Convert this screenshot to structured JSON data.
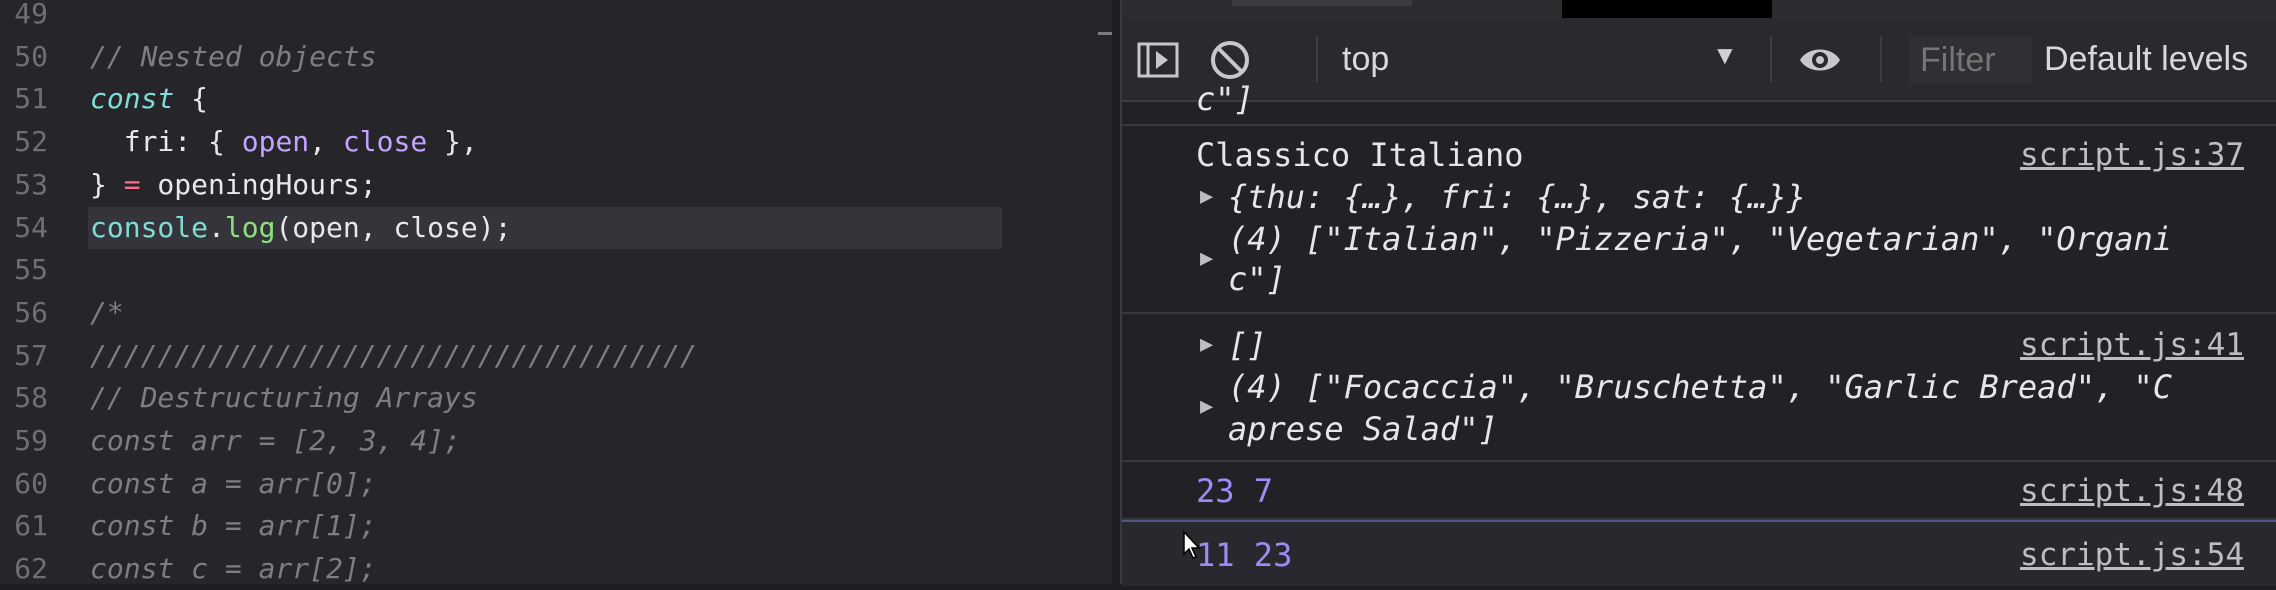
{
  "editor": {
    "lines": [
      {
        "num": "49",
        "tokens": []
      },
      {
        "num": "50",
        "tokens": [
          {
            "t": "// Nested objects",
            "c": "com"
          }
        ]
      },
      {
        "num": "51",
        "tokens": [
          {
            "t": "const",
            "c": "kw"
          },
          {
            "t": " {",
            "c": "txt"
          }
        ]
      },
      {
        "num": "52",
        "tokens": [
          {
            "t": "  fri",
            "c": "txt"
          },
          {
            "t": ": { ",
            "c": "txt"
          },
          {
            "t": "open",
            "c": "prop"
          },
          {
            "t": ", ",
            "c": "txt"
          },
          {
            "t": "close",
            "c": "prop"
          },
          {
            "t": " },",
            "c": "txt"
          }
        ]
      },
      {
        "num": "53",
        "tokens": [
          {
            "t": "} ",
            "c": "txt"
          },
          {
            "t": "=",
            "c": "op"
          },
          {
            "t": " openingHours;",
            "c": "txt"
          }
        ]
      },
      {
        "num": "54",
        "tokens": [
          {
            "t": "console",
            "c": "cons"
          },
          {
            "t": ".",
            "c": "txt"
          },
          {
            "t": "log",
            "c": "fn"
          },
          {
            "t": "(open, close);",
            "c": "txt"
          }
        ],
        "active": true
      },
      {
        "num": "55",
        "tokens": []
      },
      {
        "num": "56",
        "tokens": [
          {
            "t": "/*",
            "c": "com"
          }
        ]
      },
      {
        "num": "57",
        "tokens": [
          {
            "t": "////////////////////////////////////",
            "c": "com"
          }
        ]
      },
      {
        "num": "58",
        "tokens": [
          {
            "t": "// Destructuring Arrays",
            "c": "com"
          }
        ]
      },
      {
        "num": "59",
        "tokens": [
          {
            "t": "const arr = [2, 3, 4];",
            "c": "com"
          }
        ]
      },
      {
        "num": "60",
        "tokens": [
          {
            "t": "const a = arr[0];",
            "c": "com"
          }
        ]
      },
      {
        "num": "61",
        "tokens": [
          {
            "t": "const b = arr[1];",
            "c": "com"
          }
        ]
      },
      {
        "num": "62",
        "tokens": [
          {
            "t": "const c = arr[2];",
            "c": "com"
          }
        ]
      }
    ]
  },
  "devtools": {
    "toolbar": {
      "sidebar_icon": "sidebar-toggle-icon",
      "clear_icon": "clear-console-icon",
      "context": "top",
      "eye_icon": "eye-icon",
      "filter_placeholder": "Filter",
      "levels": "Default levels"
    },
    "console": {
      "partial_top": "c\"]",
      "messages": [
        {
          "source": "script.js:37",
          "lines": [
            "Classico Italiano",
            "{thu: {…}, fri: {…}, sat: {…}}",
            "(4) [\"Italian\", \"Pizzeria\", \"Vegetarian\", \"Organi",
            "c\"]"
          ]
        },
        {
          "source": "script.js:41",
          "lines": [
            "[]",
            "(4) [\"Focaccia\", \"Bruschetta\", \"Garlic Bread\", \"C",
            "aprese Salad\"]"
          ]
        },
        {
          "source": "script.js:48",
          "value": "23 7"
        },
        {
          "source": "script.js:54",
          "value": "11 23"
        }
      ]
    }
  },
  "colors": {
    "accent_number": "#9e8cf5",
    "string": "#f08a5d",
    "keyword": "#7fdcd6",
    "function": "#8ee07d"
  }
}
